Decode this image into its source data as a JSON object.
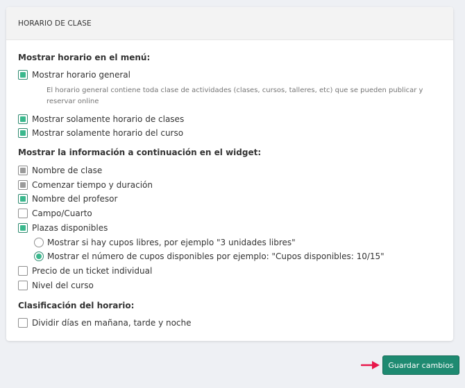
{
  "card": {
    "title": "HORARIO DE CLASE",
    "menu_section": {
      "title": "Mostrar horario en el menú:",
      "items": [
        {
          "label": "Mostrar horario general",
          "state": "checked"
        },
        {
          "label": "Mostrar solamente horario de clases",
          "state": "checked"
        },
        {
          "label": "Mostrar solamente horario del curso",
          "state": "checked"
        }
      ],
      "hint": "El horario general contiene toda clase de actividades (clases, cursos, talleres, etc) que se pueden publicar y reservar online"
    },
    "widget_section": {
      "title": "Mostrar la información a continuación en el widget:",
      "items": [
        {
          "label": "Nombre de clase",
          "state": "partial"
        },
        {
          "label": "Comenzar tiempo y duración",
          "state": "partial"
        },
        {
          "label": "Nombre del profesor",
          "state": "checked"
        },
        {
          "label": "Campo/Cuarto",
          "state": "unchecked"
        },
        {
          "label": "Plazas disponibles",
          "state": "checked"
        },
        {
          "label": "Precio de un ticket individual",
          "state": "unchecked"
        },
        {
          "label": "Nivel del curso",
          "state": "unchecked"
        }
      ],
      "radios": [
        {
          "label": "Mostrar si hay cupos libres, por ejemplo \"3 unidades libres\"",
          "selected": false
        },
        {
          "label": "Mostrar el número de cupos disponibles por ejemplo: \"Cupos disponibles: 10/15\"",
          "selected": true
        }
      ]
    },
    "classification_section": {
      "title": "Clasificación del horario:",
      "items": [
        {
          "label": "Dividir días en mañana, tarde y noche",
          "state": "unchecked"
        }
      ]
    }
  },
  "footer": {
    "save_label": "Guardar cambios"
  },
  "colors": {
    "accent": "#1e8a71",
    "check_fill": "#3ab88d",
    "arrow": "#e8174a"
  }
}
